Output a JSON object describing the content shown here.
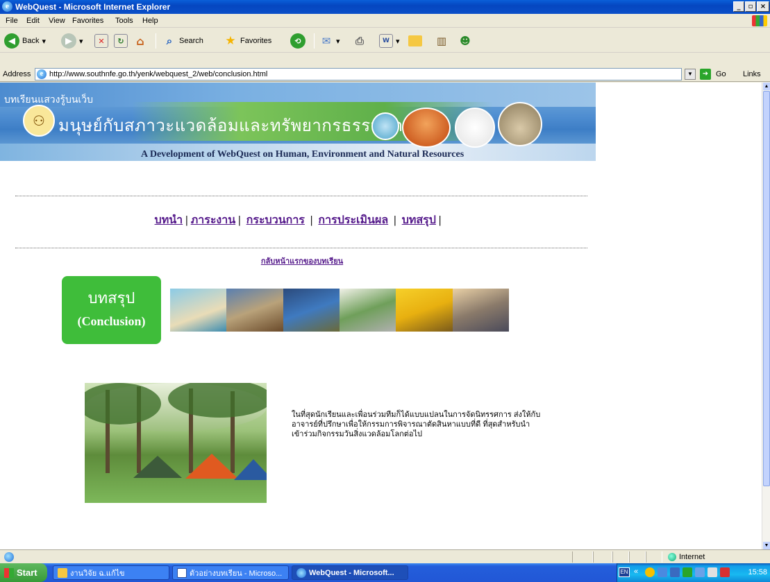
{
  "window": {
    "title": "WebQuest - Microsoft Internet Explorer",
    "buttons": {
      "minimize": "_",
      "maximize": "▫",
      "close": "×"
    }
  },
  "menu": [
    "File",
    "Edit",
    "View",
    "Favorites",
    "Tools",
    "Help"
  ],
  "toolbar": {
    "back": "Back",
    "search": "Search",
    "favorites": "Favorites"
  },
  "address": {
    "label": "Address",
    "url": "http://www.southnfe.go.th/yenk/webquest_2/web/conclusion.html",
    "go": "Go",
    "links": "Links"
  },
  "page": {
    "banner": {
      "tag": "บทเรียนแสวงรู้บนเว็บ",
      "thai_title": "มนุษย์กับสภาวะแวดล้อมและทรัพยากรธรรมชาติ",
      "subtitle": "A Development of WebQuest on Human, Environment and Natural Resources"
    },
    "nav": [
      {
        "label": "บทนำ"
      },
      {
        "label": "ภาระงาน"
      },
      {
        "label": "กระบวนการ"
      },
      {
        "label": "การประเมินผล"
      },
      {
        "label": "บทสรุป"
      }
    ],
    "back_link": "กลับหน้าแรกของบทเรียน",
    "section": {
      "thai": "บทสรุป",
      "english": "(Conclusion)"
    },
    "paragraph": "ในที่สุดนักเรียนและเพื่อนร่วมทีมก็ได้แบบแปลนในการจัดนิทรรศการ ส่งให้กับอาจารย์ที่ปรึกษาเพื่อให้กรรมการพิจารณาตัดสินหาแบบที่ดี ที่สุดสำหรับนำเข้าร่วมกิจกรรมวันสิ่งแวดล้อมโลกต่อไป"
  },
  "status": {
    "zone": "Internet"
  },
  "taskbar": {
    "start": "Start",
    "tasks": [
      {
        "label": "งานวิจัย ฉ.แก้ไข"
      },
      {
        "label": "ตัวอย่างบทเรียน - Microso..."
      },
      {
        "label": "WebQuest - Microsoft..."
      }
    ],
    "lang": "EN",
    "time": "15:58"
  }
}
